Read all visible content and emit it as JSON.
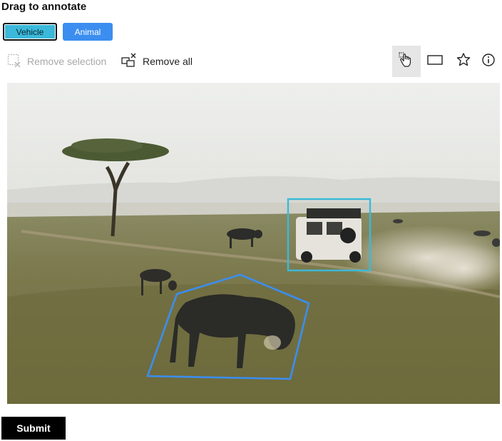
{
  "heading": "Drag to annotate",
  "labels": {
    "vehicle": "Vehicle",
    "animal": "Animal",
    "vehicle_color": "#3bb9da",
    "animal_color": "#3b8ef0"
  },
  "actions": {
    "remove_selection": "Remove selection",
    "remove_all": "Remove all"
  },
  "tools": [
    "pan-hand-icon",
    "rectangle-icon",
    "polygon-star-icon",
    "info-icon"
  ],
  "active_tool": "pan",
  "annotations": [
    {
      "label": "Vehicle",
      "shape": "rectangle",
      "color": "#3bb9da"
    },
    {
      "label": "Animal",
      "shape": "polygon",
      "color": "#3b8ef0"
    }
  ],
  "submit_label": "Submit"
}
